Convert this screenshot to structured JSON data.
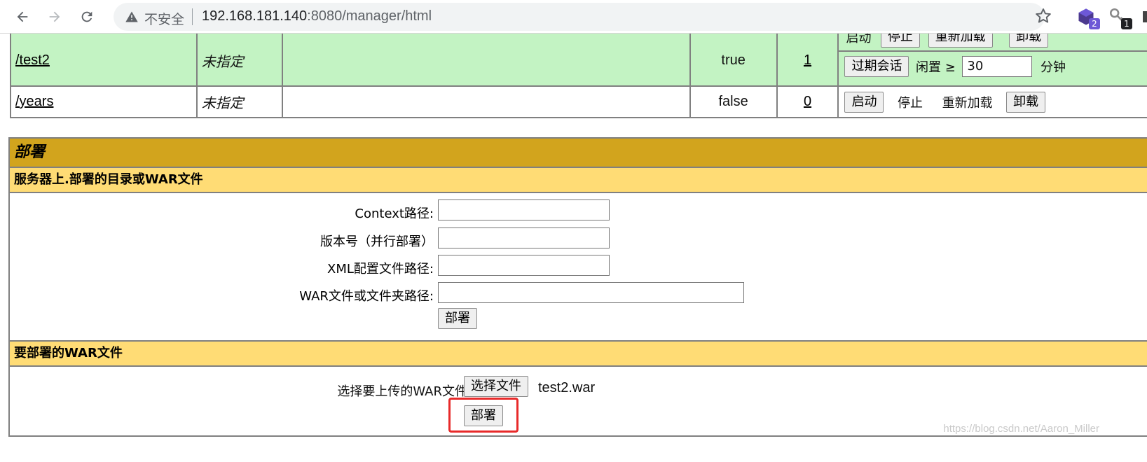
{
  "browser": {
    "security_label": "不安全",
    "url_host": "192.168.181.140",
    "url_path": ":8080/manager/html",
    "ext1_badge": "2",
    "ext2_badge": "1",
    "colors": {
      "ext1": "#4c3a8f",
      "ext1_badge": "#6d58d6",
      "ext2_badge": "#202124"
    }
  },
  "apps": [
    {
      "path": "/test2",
      "display_name": "未指定",
      "running": "true",
      "sessions": "1",
      "cmd_top": [
        "启动",
        "停止",
        "重新加载",
        "卸载"
      ],
      "expire_button": "过期会话",
      "idle_label": "闲置 ≥",
      "idle_value": "30",
      "minutes_label": "分钟"
    },
    {
      "path": "/years",
      "display_name": "未指定",
      "running": "false",
      "sessions": "0",
      "start": "启动",
      "stop": "停止",
      "reload": "重新加载",
      "undeploy": "卸载"
    }
  ],
  "deploy": {
    "title": "部署",
    "server_section": {
      "header": "服务器上.部署的目录或WAR文件",
      "context_label": "Context路径:",
      "version_label": "版本号（并行部署）",
      "xml_label": "XML配置文件路径:",
      "war_label": "WAR文件或文件夹路径:",
      "deploy_button": "部署"
    },
    "upload_section": {
      "header": "要部署的WAR文件",
      "select_label": "选择要上传的WAR文件",
      "choose_button": "选择文件",
      "file_name": "test2.war",
      "deploy_button": "部署"
    }
  },
  "watermark": "https://blog.csdn.net/Aaron_Miller",
  "colors": {
    "title_bar": "#d2a41d",
    "sub_header": "#ffdc75",
    "running_row": "#c3f3c3",
    "highlight": "#e82a2a"
  }
}
